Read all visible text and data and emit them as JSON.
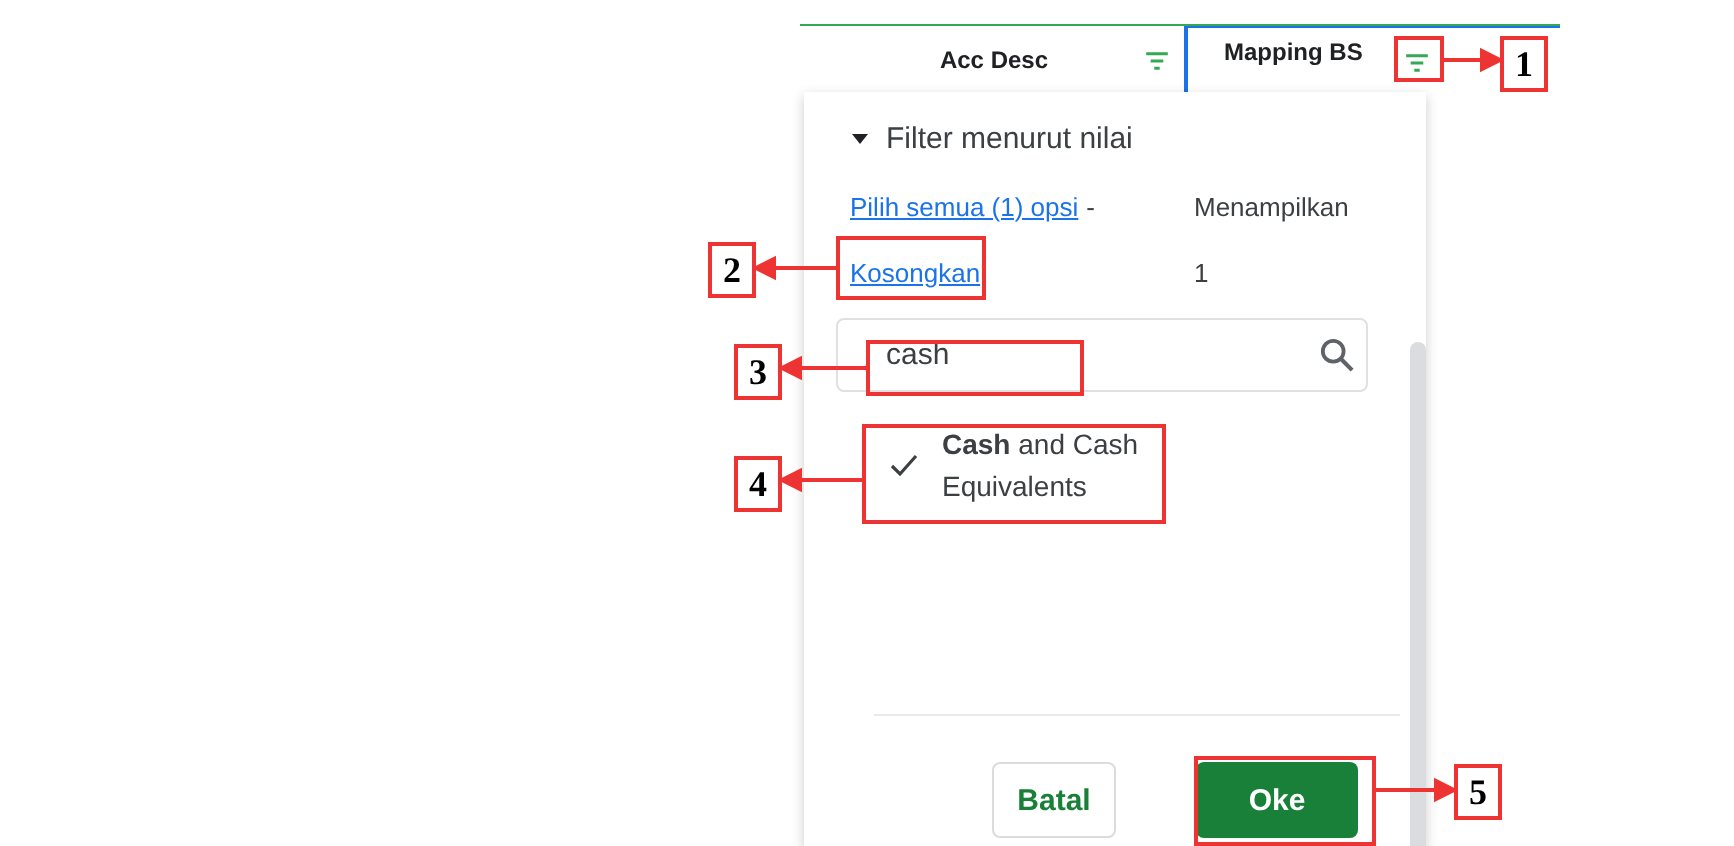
{
  "columns": [
    {
      "label": "Acc Desc",
      "selected": false
    },
    {
      "label": "Mapping BS",
      "selected": true
    }
  ],
  "filter": {
    "section_title": "Filter menurut nilai",
    "expanded": true,
    "select_all": "Pilih semua (1) opsi",
    "separator": "-",
    "showing_label": "Menampilkan",
    "clear": "Kosongkan",
    "count": "1",
    "search_value": "cash",
    "items": [
      {
        "label": "**Cash** and Cash Equivalents",
        "checked": true
      }
    ],
    "buttons": [
      {
        "label": "Batal",
        "kind": "secondary"
      },
      {
        "label": "Oke",
        "kind": "primary"
      }
    ]
  },
  "callouts": [
    {
      "label": "1"
    },
    {
      "label": "2"
    },
    {
      "label": "3"
    },
    {
      "label": "4"
    },
    {
      "label": "5"
    }
  ]
}
